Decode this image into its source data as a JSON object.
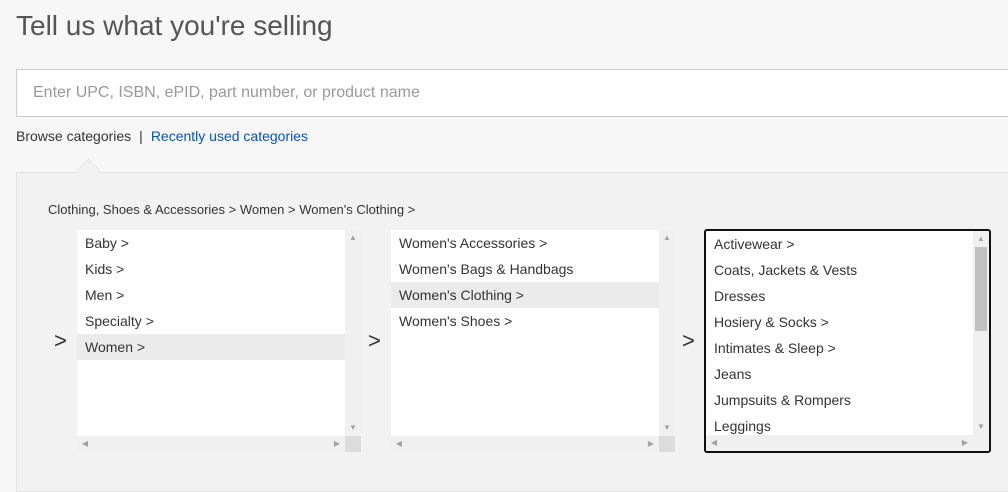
{
  "header": {
    "title": "Tell us what you're selling"
  },
  "search": {
    "placeholder": "Enter UPC, ISBN, ePID, part number, or product name"
  },
  "links": {
    "browse": "Browse categories",
    "separator": "|",
    "recent": "Recently used categories"
  },
  "breadcrumb": "Clothing, Shoes & Accessories > Women > Women's Clothing >",
  "arrow_glyph": ">",
  "columns": [
    {
      "items": [
        "Baby >",
        "Kids >",
        "Men >",
        "Specialty >",
        "Women >"
      ],
      "selected": "Women >"
    },
    {
      "items": [
        "Women's Accessories >",
        "Women's Bags & Handbags",
        "Women's Clothing >",
        "Women's Shoes >"
      ],
      "selected": "Women's Clothing >"
    },
    {
      "items": [
        "Activewear >",
        "Coats, Jackets & Vests",
        "Dresses",
        "Hosiery & Socks >",
        "Intimates & Sleep >",
        "Jeans",
        "Jumpsuits & Rompers",
        "Leggings"
      ],
      "selected": null
    }
  ],
  "icons": {
    "up": "▲",
    "down": "▼",
    "left": "◀",
    "right": "▶"
  }
}
